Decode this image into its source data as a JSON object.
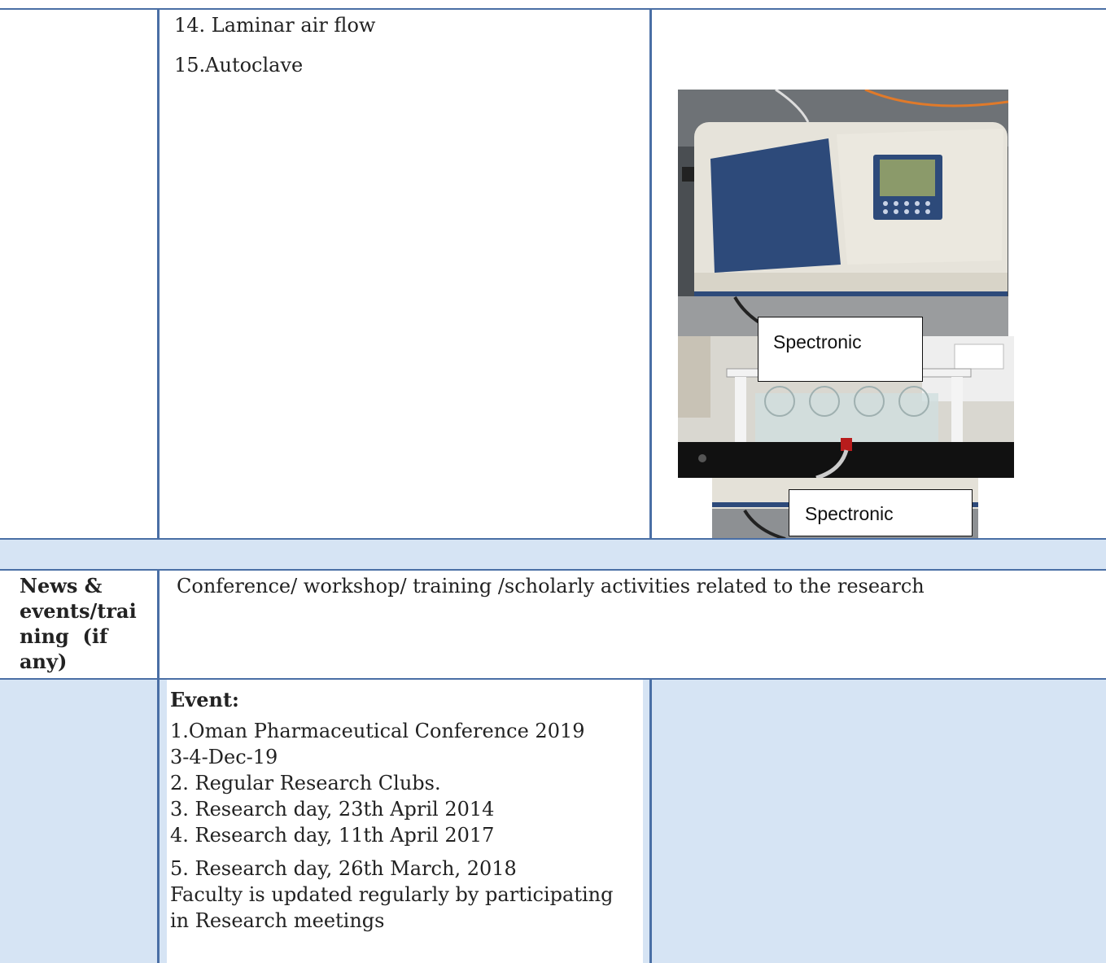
{
  "equipment": {
    "items": [
      "14. Laminar air flow",
      "15.Autoclave"
    ],
    "photo_captions": [
      "Spectronic",
      "Spectronic"
    ]
  },
  "news": {
    "row_label": [
      "News &",
      "events/trai",
      "ning  (if",
      "any)"
    ],
    "heading": "Conference/ workshop/ training /scholarly activities related to the research"
  },
  "events": {
    "title": "Event:",
    "lines": [
      "1.Oman Pharmaceutical Conference 2019",
      "3-4-Dec-19",
      "2. Regular Research Clubs.",
      "3. Research day, 23th April 2014",
      "4. Research day, 11th April 2017",
      "5. Research day, 26th March, 2018",
      "Faculty is updated regularly by participating",
      "in Research meetings"
    ]
  },
  "colors": {
    "border": "#4a6fa5",
    "shade": "#d6e4f4"
  }
}
